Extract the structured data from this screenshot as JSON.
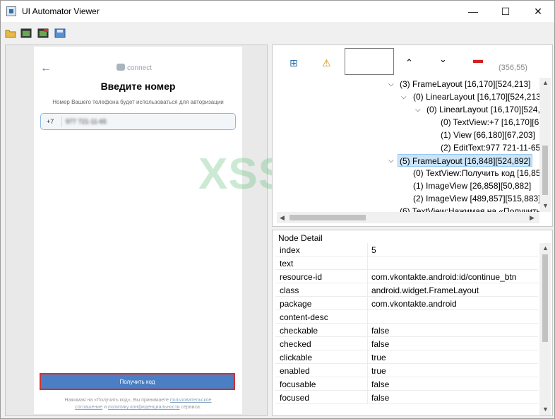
{
  "window": {
    "title": "UI Automator Viewer",
    "minimize": "—",
    "maximize": "☐",
    "close": "✕"
  },
  "device": {
    "brand": "connect",
    "heading": "Введите номер",
    "subtitle": "Номер Вашего телефона будет использоваться для авторизации",
    "country_code": "+7",
    "phone_value": "977 721-11-65",
    "button_label": "Получить код",
    "terms_line1_a": "Нажимая на «Получить код», Вы принимаете ",
    "terms_link1": "пользовательское",
    "terms_link1b": "соглашение",
    "terms_line2_a": " и ",
    "terms_link2": "политику конфиденциальности",
    "terms_line2_b": " сервиса."
  },
  "watermark": "XSS.is",
  "controls": {
    "coords": "(356,55)"
  },
  "tree": [
    {
      "text": "(3) FrameLayout [16,170][524,213]"
    },
    {
      "text": "(0) LinearLayout [16,170][524,213]"
    },
    {
      "text": "(0) LinearLayout [16,170][524,2"
    },
    {
      "text": "(0) TextView:+7 [16,170][66"
    },
    {
      "text": "(1) View [66,180][67,203]"
    },
    {
      "text": "(2) EditText:977 721-11-65"
    },
    {
      "text": "(5) FrameLayout [16,848][524,892]"
    },
    {
      "text": "(0) TextView:Получить код [16,85"
    },
    {
      "text": "(1) ImageView [26,858][50,882]"
    },
    {
      "text": "(2) ImageView [489,857][515,883]"
    },
    {
      "text": "(6) TextView:Нажимая на «Получить"
    }
  ],
  "detail": {
    "title": "Node Detail",
    "rows": [
      {
        "key": "index",
        "value": "5"
      },
      {
        "key": "text",
        "value": ""
      },
      {
        "key": "resource-id",
        "value": "com.vkontakte.android:id/continue_btn"
      },
      {
        "key": "class",
        "value": "android.widget.FrameLayout"
      },
      {
        "key": "package",
        "value": "com.vkontakte.android"
      },
      {
        "key": "content-desc",
        "value": ""
      },
      {
        "key": "checkable",
        "value": "false"
      },
      {
        "key": "checked",
        "value": "false"
      },
      {
        "key": "clickable",
        "value": "true"
      },
      {
        "key": "enabled",
        "value": "true"
      },
      {
        "key": "focusable",
        "value": "false"
      },
      {
        "key": "focused",
        "value": "false"
      }
    ]
  },
  "colors": {
    "accent": "#4a7fc5",
    "highlight": "#cc3333",
    "selection": "#cce4f7"
  }
}
